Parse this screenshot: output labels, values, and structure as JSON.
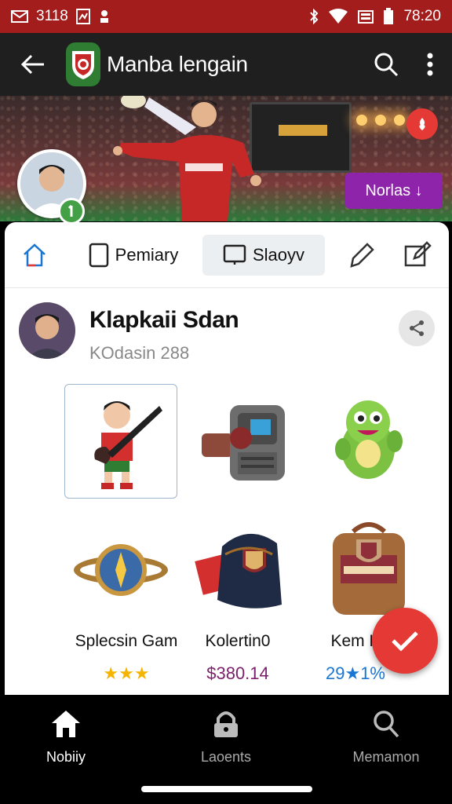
{
  "status_bar": {
    "left_text": "3118",
    "time": "78:20"
  },
  "app_bar": {
    "title": "Manba lengain"
  },
  "hero": {
    "chip_label": "Norlas ↓"
  },
  "tabs": [
    {
      "label": ""
    },
    {
      "label": "Pemiary"
    },
    {
      "label": "Slaoyv"
    },
    {
      "label": ""
    },
    {
      "label": ""
    }
  ],
  "profile": {
    "name": "Klapkaii Sdan",
    "subtitle": "KOdasin 288"
  },
  "items": [
    {
      "label": "Splecsin Gam",
      "price": "★★★",
      "price_color": "#f4b400"
    },
    {
      "label": "Kolertin0",
      "price": "$380.14",
      "price_color": "#7b1f6a"
    },
    {
      "label": "Kem K",
      "price": "29★1%",
      "price_color": "#1976d2"
    }
  ],
  "bottom_nav": [
    {
      "label": "Nobiiy",
      "icon": "home-icon"
    },
    {
      "label": "Laoents",
      "icon": "lock-icon"
    },
    {
      "label": "Memamon",
      "icon": "search-icon"
    }
  ],
  "colors": {
    "status": "#a31d1d",
    "accent": "#e53935",
    "chip": "#8e24aa",
    "badge": "#43a047"
  }
}
